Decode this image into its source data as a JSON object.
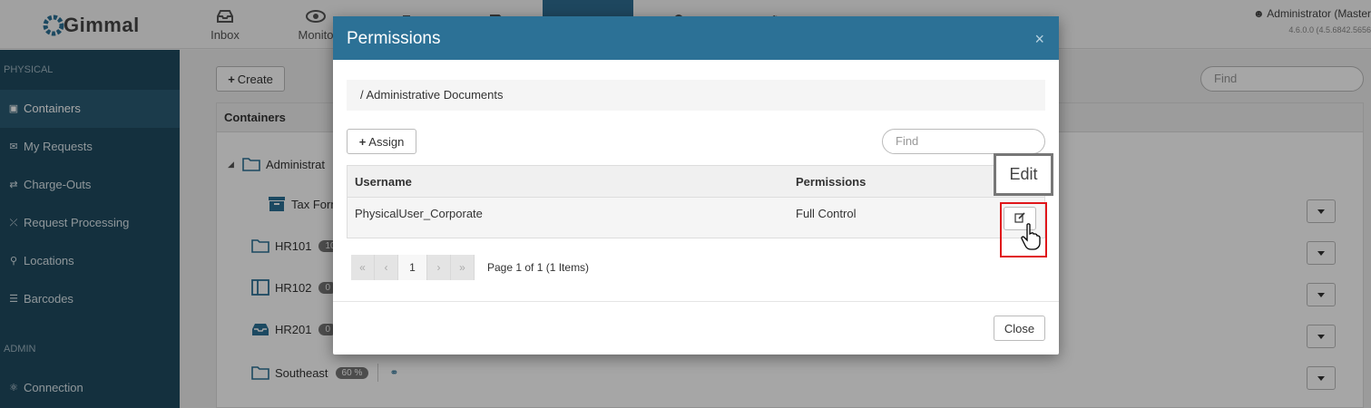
{
  "app": {
    "logo_text": "Gimmal",
    "user_name": "Administrator (Master",
    "version": "4.6.0.0 (4.5.6842.5656"
  },
  "nav": {
    "items": [
      {
        "label": "Inbox",
        "icon": "inbox-icon"
      },
      {
        "label": "Monito",
        "icon": "eye-icon"
      },
      {
        "label": "",
        "icon": "briefcase-icon"
      },
      {
        "label": "",
        "icon": "document-icon"
      },
      {
        "label": "",
        "icon": "archive-box-icon",
        "active": true
      },
      {
        "label": "",
        "icon": "lock-icon"
      },
      {
        "label": "",
        "icon": "gears-icon"
      },
      {
        "label": "",
        "icon": "sign-out-icon"
      }
    ]
  },
  "sidebar": {
    "section_physical": "PHYSICAL",
    "section_admin": "ADMIN",
    "items": [
      {
        "label": "Containers",
        "icon": "archive-icon",
        "active": true
      },
      {
        "label": "My Requests",
        "icon": "envelope-icon"
      },
      {
        "label": "Charge-Outs",
        "icon": "exchange-icon"
      },
      {
        "label": "Request Processing",
        "icon": "random-icon"
      },
      {
        "label": "Locations",
        "icon": "map-marker-icon"
      },
      {
        "label": "Barcodes",
        "icon": "barcode-icon"
      }
    ],
    "admin_items": [
      {
        "label": "Connection",
        "icon": "plug-icon"
      }
    ]
  },
  "main": {
    "create_label": "Create",
    "find_placeholder": "Find",
    "panel_title": "Containers",
    "tree": [
      {
        "label": "Administrat",
        "badge": ""
      },
      {
        "label": "Tax Form",
        "badge": ""
      },
      {
        "label": "HR101",
        "badge": "10"
      },
      {
        "label": "HR102",
        "badge": "0"
      },
      {
        "label": "HR201",
        "badge": "0"
      },
      {
        "label": "Southeast",
        "badge": "60 %"
      }
    ]
  },
  "modal": {
    "title": "Permissions",
    "close_x": "×",
    "breadcrumb": "/ Administrative Documents",
    "assign_label": "Assign",
    "find_placeholder": "Find",
    "columns": {
      "username": "Username",
      "permissions": "Permissions"
    },
    "rows": [
      {
        "username": "PhysicalUser_Corporate",
        "permissions": "Full Control"
      }
    ],
    "pager": {
      "current": "1",
      "info": "Page 1 of 1 (1 Items)"
    },
    "close_label": "Close"
  },
  "tooltip": {
    "text": "Edit"
  },
  "colors": {
    "header_blue": "#2c7196",
    "sidebar": "#1f4a60",
    "highlight_red": "#e0161a"
  }
}
